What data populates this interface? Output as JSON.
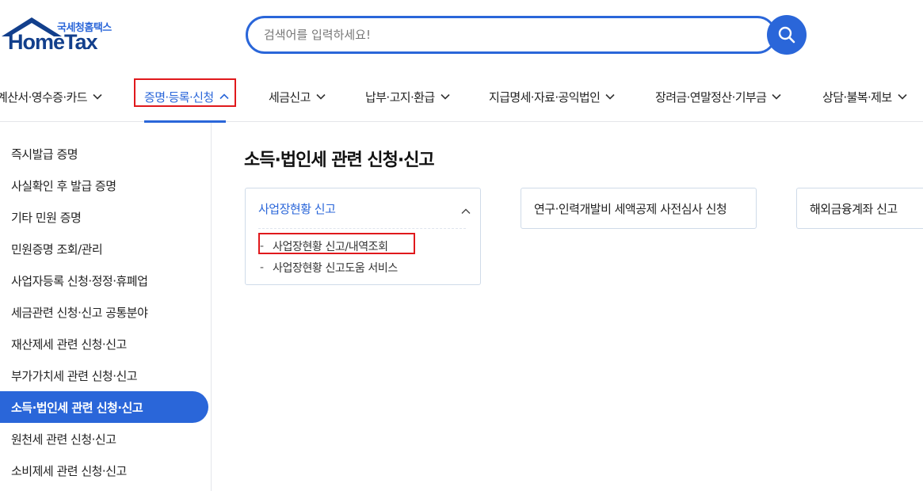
{
  "logo": {
    "sub": "국세청홈택스",
    "main": "HomeTax"
  },
  "search": {
    "placeholder": "검색어를 입력하세요!",
    "icon": "search-icon"
  },
  "topnav": {
    "items": [
      {
        "label": "계산서·영수증·카드"
      },
      {
        "label": "증명·등록·신청",
        "active": true
      },
      {
        "label": "세금신고"
      },
      {
        "label": "납부·고지·환급"
      },
      {
        "label": "지급명세·자료·공익법인"
      },
      {
        "label": "장려금·연말정산·기부금"
      },
      {
        "label": "상담·불복·제보"
      }
    ]
  },
  "sidebar": {
    "items": [
      {
        "label": "즉시발급 증명"
      },
      {
        "label": "사실확인 후 발급 증명"
      },
      {
        "label": "기타 민원 증명"
      },
      {
        "label": "민원증명 조회/관리"
      },
      {
        "label": "사업자등록 신청·정정·휴폐업"
      },
      {
        "label": "세금관련 신청·신고 공통분야"
      },
      {
        "label": "재산제세 관련 신청·신고"
      },
      {
        "label": "부가가치세 관련 신청·신고"
      },
      {
        "label": "소득·법인세 관련 신청·신고",
        "active": true
      },
      {
        "label": "원천세 관련 신청·신고"
      },
      {
        "label": "소비제세 관련 신청·신고"
      }
    ]
  },
  "main": {
    "title": "소득·법인세 관련 신청·신고",
    "cards": [
      {
        "title": "사업장현황 신고",
        "expanded": true,
        "links": [
          {
            "dash": "-",
            "label": "사업장현황 신고/내역조회"
          },
          {
            "dash": "-",
            "label": "사업장현황 신고도움 서비스"
          }
        ]
      },
      {
        "title": "연구·인력개발비 세액공제 사전심사 신청"
      },
      {
        "title": "해외금융계좌 신고"
      }
    ]
  },
  "colors": {
    "accent": "#2a66d9",
    "highlight": "#e0191c",
    "logo_dark": "#123f8c"
  }
}
